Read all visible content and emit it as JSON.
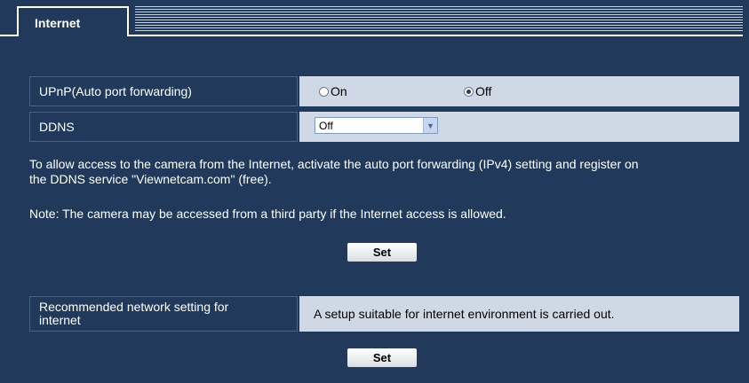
{
  "tab": {
    "label": "Internet"
  },
  "upnp": {
    "label": "UPnP(Auto port forwarding)",
    "options": [
      {
        "label": "On",
        "checked": false
      },
      {
        "label": "Off",
        "checked": true
      }
    ]
  },
  "ddns": {
    "label": "DDNS",
    "selected": "Off",
    "arrow": "chevron-down-icon"
  },
  "info": {
    "line1": "To allow access to the camera from the Internet, activate the auto port forwarding (IPv4) setting and register on",
    "line2": "the DDNS service \"Viewnetcam.com\" (free).",
    "note": "Note: The camera may be accessed from a third party if the Internet access is allowed."
  },
  "set_button_1": {
    "label": "Set"
  },
  "recommended": {
    "label_line1": "Recommended network setting for",
    "label_line2": "internet",
    "value": "A setup suitable for internet environment is carried out."
  },
  "set_button_2": {
    "label": "Set"
  }
}
